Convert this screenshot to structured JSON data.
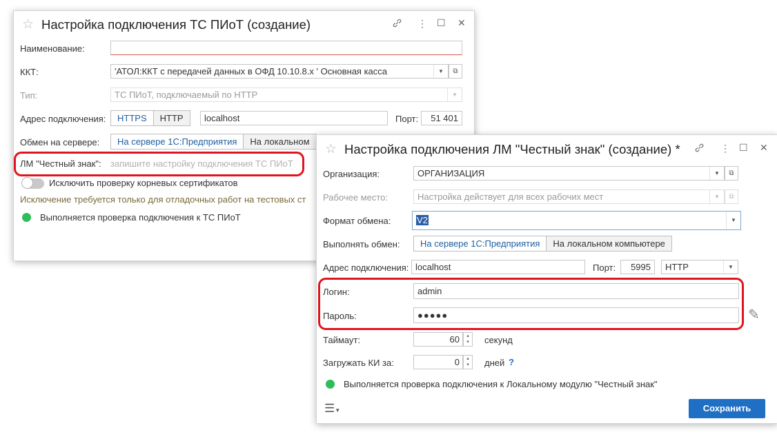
{
  "window1": {
    "title": "Настройка подключения ТС ПИоТ (создание)",
    "name_label": "Наименование:",
    "name_value": "",
    "kkt_label": "ККТ:",
    "kkt_value": "'АТОЛ:ККТ с передачей данных в ОФД 10.10.8.x ' Основная касса",
    "type_label": "Тип:",
    "type_value": "ТС ПИоТ, подключаемый по HTTP",
    "address_label": "Адрес подключения:",
    "protocol_options": [
      "HTTPS",
      "HTTP"
    ],
    "host_value": "localhost",
    "port_label": "Порт:",
    "port_value": "51 401",
    "exchange_label": "Обмен на сервере:",
    "exchange_options": [
      "На сервере 1С:Предприятия",
      "На локальном"
    ],
    "lm_label": "ЛМ \"Честный знак\":",
    "lm_hint": "запишите настройку подключения ТС ПИоТ",
    "toggle_label": "Исключить проверку корневых сертификатов",
    "toggle_on": false,
    "warning_text": "Исключение требуется только для отладочных работ на тестовых ст",
    "status_text": "Выполняется проверка подключения к ТС ПИоТ"
  },
  "window2": {
    "title": "Настройка подключения ЛМ \"Честный знак\" (создание) *",
    "org_label": "Организация:",
    "org_value": "ОРГАНИЗАЦИЯ",
    "workplace_label": "Рабочее место:",
    "workplace_value": "Настройка действует для всех рабочих мест",
    "format_label": "Формат обмена:",
    "format_value": "V2",
    "exchange_label": "Выполнять обмен:",
    "exchange_options": [
      "На сервере 1С:Предприятия",
      "На локальном компьютере"
    ],
    "address_label": "Адрес подключения:",
    "host_value": "localhost",
    "port_label": "Порт:",
    "port_value": "5995",
    "protocol_value": "HTTP",
    "login_label": "Логин:",
    "login_value": "admin",
    "password_label": "Пароль:",
    "password_value": "●●●●●",
    "timeout_label": "Таймаут:",
    "timeout_value": "60",
    "timeout_unit": "секунд",
    "load_label": "Загружать КИ за:",
    "load_value": "0",
    "load_unit": "дней",
    "help_mark": "?",
    "status_text": "Выполняется проверка подключения к Локальному модулю \"Честный знак\"",
    "save_label": "Сохранить"
  },
  "icons": {
    "star": "☆",
    "link": "🔗",
    "more": "⋮",
    "maximize": "☐",
    "close": "✕",
    "dropdown": "▼",
    "open": "⧉",
    "menu": "☰",
    "pencil": "✎"
  },
  "colors": {
    "accent": "#1f6fc5",
    "highlight": "#e0141e",
    "status_ok": "#2dbd59"
  }
}
